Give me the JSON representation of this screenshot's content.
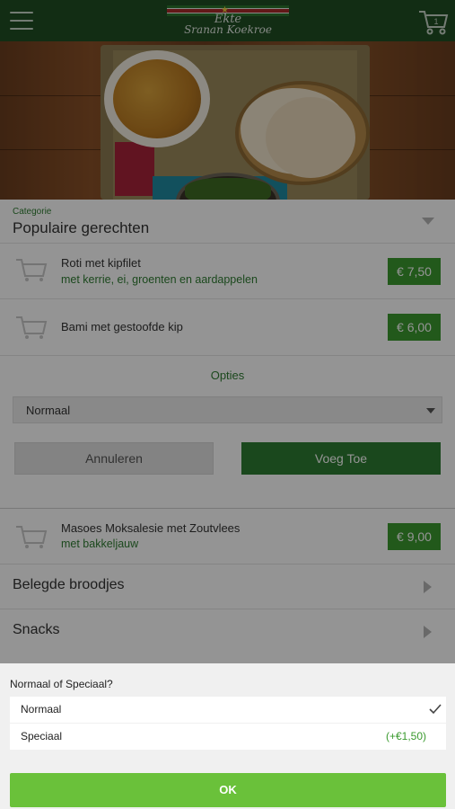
{
  "header": {
    "logo_line1": "Ekte",
    "logo_line2": "Sranan Koekroe"
  },
  "category": {
    "label": "Categorie",
    "title": "Populaire gerechten"
  },
  "items": [
    {
      "name": "Roti met kipfilet",
      "subtitle": "met kerrie, ei, groenten en aardappelen",
      "price": "€ 7,50"
    },
    {
      "name": "Bami met gestoofde kip",
      "subtitle": "",
      "price": "€ 6,00"
    },
    {
      "name": "Masoes Moksalesie met Zoutvlees",
      "subtitle": "met bakkeljauw",
      "price": "€ 9,00"
    }
  ],
  "options_panel": {
    "title": "Opties",
    "selected": "Normaal",
    "cancel_label": "Annuleren",
    "add_label": "Voeg Toe"
  },
  "categories": [
    "Belegde broodjes",
    "Snacks"
  ],
  "sheet": {
    "question": "Normaal of Speciaal?",
    "options": [
      {
        "label": "Normaal",
        "extra": "",
        "selected": true
      },
      {
        "label": "Speciaal",
        "extra": "(+€1,50)",
        "selected": false
      }
    ],
    "ok_label": "OK"
  },
  "colors": {
    "header": "#1f4e23",
    "accent_green": "#2e7d32",
    "price_green": "#3c9a30",
    "ok_green": "#6ac13a"
  }
}
